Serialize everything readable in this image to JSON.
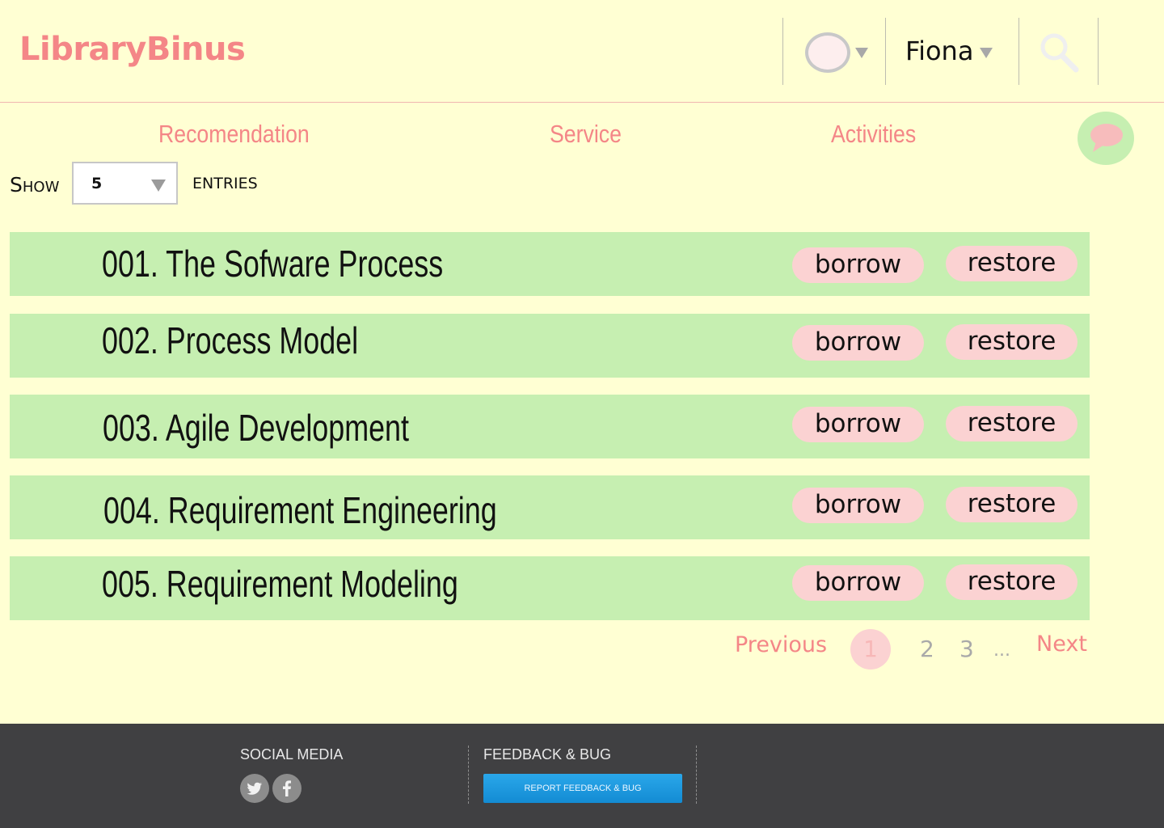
{
  "header": {
    "logo": "LibraryBinus",
    "user_name": "Fiona"
  },
  "nav": {
    "items": [
      "Recomendation",
      "Service",
      "Activities"
    ]
  },
  "entries": {
    "show_label": "Show",
    "value": "5",
    "entries_label": "ENTRIES"
  },
  "books": [
    {
      "title": "001. The Sofware Process",
      "borrow": "borrow",
      "restore": "restore"
    },
    {
      "title": "002. Process Model",
      "borrow": "borrow",
      "restore": "restore"
    },
    {
      "title": "003. Agile Development",
      "borrow": "borrow",
      "restore": "restore"
    },
    {
      "title": "004. Requirement Engineering",
      "borrow": "borrow",
      "restore": "restore"
    },
    {
      "title": "005. Requirement Modeling",
      "borrow": "borrow",
      "restore": "restore"
    }
  ],
  "pagination": {
    "previous": "Previous",
    "pages": [
      "1",
      "2",
      "3"
    ],
    "current": "1",
    "ellipsis": "...",
    "next": "Next"
  },
  "footer": {
    "social_heading": "SOCIAL MEDIA",
    "social_icons": [
      "twitter-icon",
      "facebook-icon"
    ],
    "feedback_heading": "FEEDBACK & BUG",
    "report_button": "REPORT FEEDBACK & BUG"
  },
  "colors": {
    "background": "#ffffd3",
    "accent": "#f48687",
    "row": "#c6efb1",
    "pill": "#fbd2d2",
    "footer": "#404042",
    "button": "#1b96dc"
  }
}
